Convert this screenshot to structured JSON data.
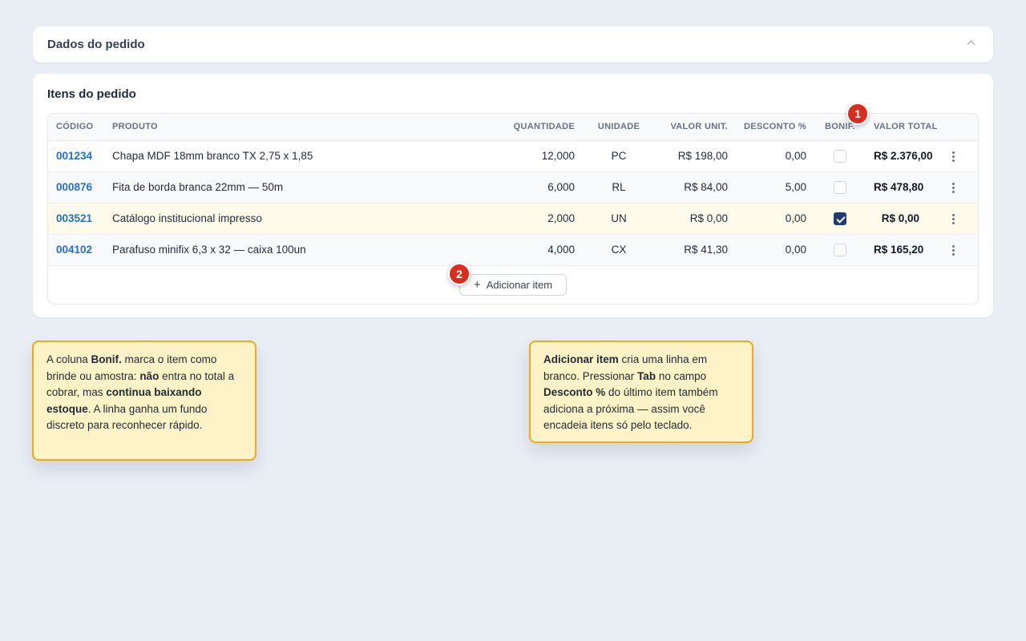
{
  "order_data_section": {
    "title": "Dados do pedido"
  },
  "items_section": {
    "title": "Itens do pedido",
    "columns": {
      "codigo": "CÓDIGO",
      "produto": "PRODUTO",
      "quantidade": "QUANTIDADE",
      "unidade": "UNIDADE",
      "valor_unit": "VALOR UNIT.",
      "desconto": "DESCONTO %",
      "bonif": "BONIF.",
      "valor_total": "VALOR TOTAL"
    },
    "rows": [
      {
        "codigo": "001234",
        "produto": "Chapa MDF 18mm branco TX 2,75 x 1,85",
        "quantidade": "12,000",
        "unidade": "PC",
        "valor_unit": "R$ 198,00",
        "desconto": "0,00",
        "bonif": false,
        "valor_total": "R$ 2.376,00"
      },
      {
        "codigo": "000876",
        "produto": "Fita de borda branca 22mm — 50m",
        "quantidade": "6,000",
        "unidade": "RL",
        "valor_unit": "R$ 84,00",
        "desconto": "5,00",
        "bonif": false,
        "valor_total": "R$ 478,80"
      },
      {
        "codigo": "003521",
        "produto": "Catálogo institucional impresso",
        "quantidade": "2,000",
        "unidade": "UN",
        "valor_unit": "R$ 0,00",
        "desconto": "0,00",
        "bonif": true,
        "valor_total": "R$ 0,00"
      },
      {
        "codigo": "004102",
        "produto": "Parafuso minifix 6,3 x 32 — caixa 100un",
        "quantidade": "4,000",
        "unidade": "CX",
        "valor_unit": "R$ 41,30",
        "desconto": "0,00",
        "bonif": false,
        "valor_total": "R$ 165,20"
      }
    ],
    "add_item_label": "Adicionar item"
  },
  "badges": {
    "one": "1",
    "two": "2"
  },
  "notes": {
    "bonif": {
      "t1": "A coluna ",
      "b1": "Bonif.",
      "t2": " marca o item como brinde ou amostra: ",
      "b2": "não",
      "t3": " entra no total a cobrar, mas ",
      "b3": "continua baixando estoque",
      "t4": ". A linha ganha um fundo discreto para reconhecer rápido."
    },
    "add_item": {
      "b1": "Adicionar item",
      "t1": " cria uma linha em branco. Pressionar ",
      "b2": "Tab",
      "t2": " no campo ",
      "b3": "Desconto %",
      "t3": " do último item também adiciona a próxima — assim você encadeia itens só pelo teclado."
    }
  },
  "colors": {
    "accent": "#1f6fd1",
    "badge": "#d92d20",
    "note_bg": "#fef3c7",
    "note_border": "#f0a81c",
    "checkbox_checked": "#1e3a6e"
  },
  "icons": {
    "collapse": "chevron-up-icon",
    "row_menu": "kebab-menu-icon",
    "add": "plus-icon",
    "check": "check-icon"
  }
}
